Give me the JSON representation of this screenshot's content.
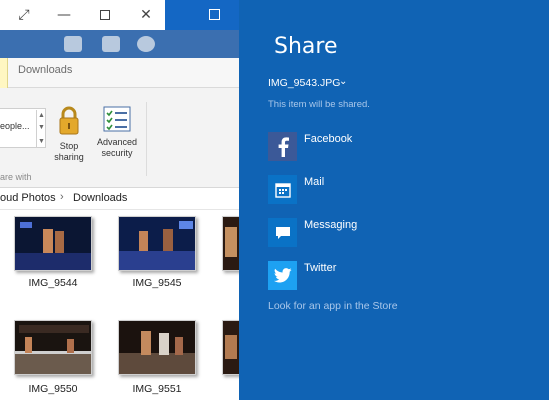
{
  "explorer": {
    "ribbon_tab": "Downloads",
    "people_text": "eople...",
    "group_label": "are with",
    "stop_sharing": "Stop sharing",
    "advanced_security": "Advanced security",
    "breadcrumb": [
      "oud Photos",
      "Downloads"
    ],
    "files": [
      {
        "name": "IMG_9544"
      },
      {
        "name": "IMG_9545"
      },
      {
        "name": "IMG_9550"
      },
      {
        "name": "IMG_9551"
      }
    ]
  },
  "share": {
    "title": "Share",
    "file_name": "IMG_9543.JPG",
    "note": "This item will be shared.",
    "apps": [
      {
        "label": "Facebook",
        "icon": "facebook-icon",
        "color": "#3b5998"
      },
      {
        "label": "Mail",
        "icon": "mail-icon",
        "color": "#0a72c6"
      },
      {
        "label": "Messaging",
        "icon": "messaging-icon",
        "color": "#0a72c6"
      },
      {
        "label": "Twitter",
        "icon": "twitter-icon",
        "color": "#1da1f2"
      }
    ],
    "store_link": "Look for an app in the Store"
  },
  "colors": {
    "share_background": "#1063b4",
    "ribbon_highlight": "#fff7c2"
  }
}
